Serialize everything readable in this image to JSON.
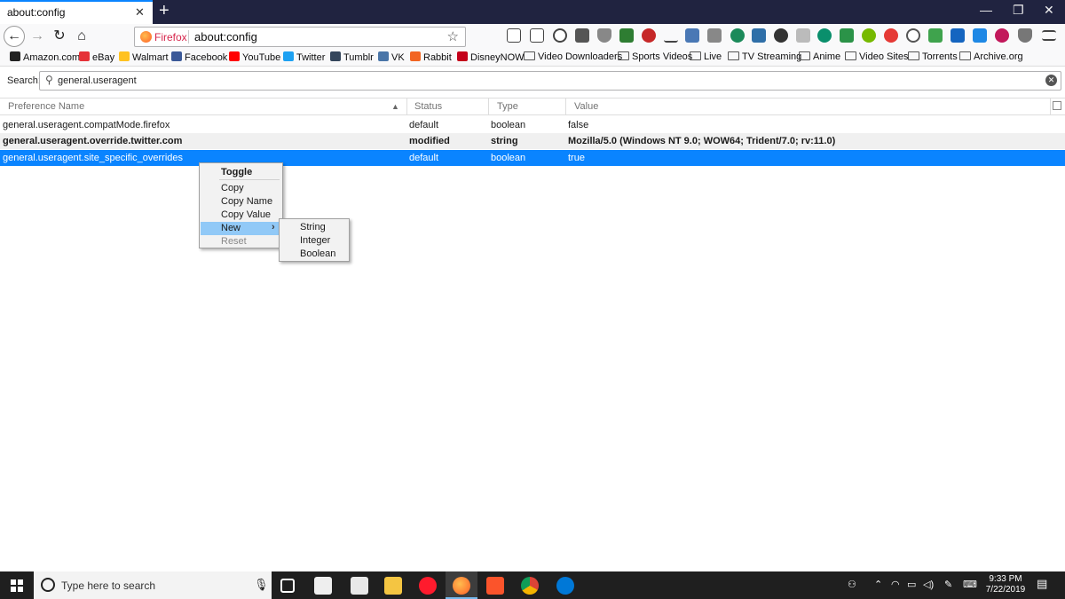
{
  "window": {
    "tab_title": "about:config",
    "tab_close": "✕",
    "new_tab": "+",
    "minimize": "—",
    "restore": "❐",
    "close": "✕"
  },
  "navbar": {
    "back": "←",
    "forward": "→",
    "reload": "↻",
    "home": "⌂",
    "identity_label": "Firefox",
    "url": "about:config",
    "star": "☆"
  },
  "bookmarks": [
    {
      "label": "Amazon.com",
      "icon": "amazon-icon",
      "color": "#222222"
    },
    {
      "label": "eBay",
      "icon": "ebay-icon",
      "color": "#e53238"
    },
    {
      "label": "Walmart",
      "icon": "walmart-icon",
      "color": "#ffc220"
    },
    {
      "label": "Facebook",
      "icon": "facebook-icon",
      "color": "#3b5998"
    },
    {
      "label": "YouTube",
      "icon": "youtube-icon",
      "color": "#ff0000"
    },
    {
      "label": "Twitter",
      "icon": "twitter-icon",
      "color": "#1da1f2"
    },
    {
      "label": "Tumblr",
      "icon": "tumblr-icon",
      "color": "#35465c"
    },
    {
      "label": "VK",
      "icon": "vk-icon",
      "color": "#4a76a8"
    },
    {
      "label": "Rabbit",
      "icon": "rabbit-icon",
      "color": "#f26522"
    },
    {
      "label": "DisneyNOW",
      "icon": "disneynow-icon",
      "color": "#c4001a"
    },
    {
      "label": "Video Downloaders",
      "icon": "folder-icon"
    },
    {
      "label": "Sports Videos",
      "icon": "folder-icon"
    },
    {
      "label": "Live",
      "icon": "folder-icon"
    },
    {
      "label": "TV Streaming",
      "icon": "folder-icon"
    },
    {
      "label": "Anime",
      "icon": "folder-icon"
    },
    {
      "label": "Video Sites",
      "icon": "folder-icon"
    },
    {
      "label": "Torrents",
      "icon": "folder-icon"
    },
    {
      "label": "Archive.org",
      "icon": "folder-icon"
    }
  ],
  "config": {
    "search_label": "Search:",
    "search_value": "general.useragent",
    "columns": [
      "Preference Name",
      "Status",
      "Type",
      "Value"
    ],
    "rows": [
      {
        "name": "general.useragent.compatMode.firefox",
        "status": "default",
        "type": "boolean",
        "value": "false"
      },
      {
        "name": "general.useragent.override.twitter.com",
        "status": "modified",
        "type": "string",
        "value": "Mozilla/5.0 (Windows NT 9.0; WOW64; Trident/7.0; rv:11.0)"
      },
      {
        "name": "general.useragent.site_specific_overrides",
        "status": "default",
        "type": "boolean",
        "value": "true"
      }
    ]
  },
  "context_menu": {
    "items": [
      "Toggle",
      "Copy",
      "Copy Name",
      "Copy Value",
      "New",
      "Reset"
    ],
    "submenu_arrow": "›",
    "submenu": [
      "String",
      "Integer",
      "Boolean"
    ]
  },
  "taskbar": {
    "search_placeholder": "Type here to search",
    "time": "9:33 PM",
    "date": "7/22/2019"
  },
  "colors": {
    "accent": "#0a84ff",
    "tabstrip": "#202340",
    "menu_highlight": "#91c9f7"
  }
}
